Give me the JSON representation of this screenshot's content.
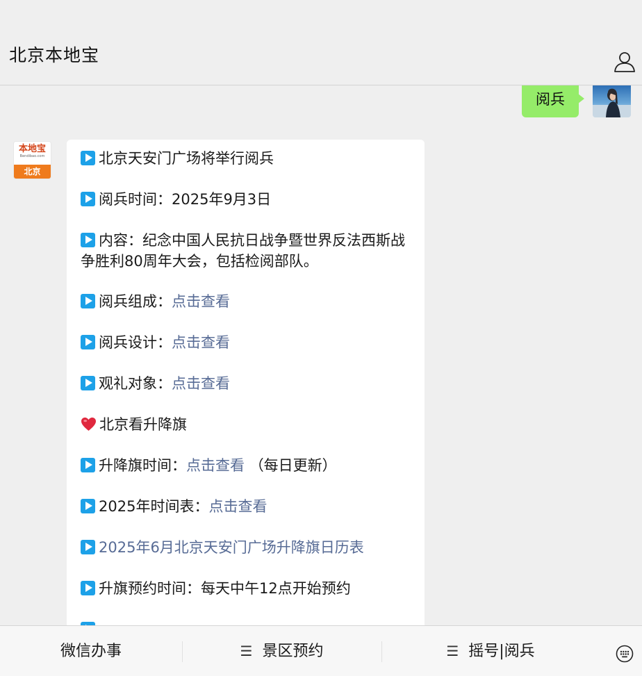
{
  "header": {
    "title": "北京本地宝"
  },
  "user_message": {
    "text": "阅兵"
  },
  "bot_avatar": {
    "brand": "本地宝",
    "url": "Bendibao.com",
    "city": "北京"
  },
  "bot_message": {
    "lines": {
      "l1": {
        "text": "北京天安门广场将举行阅兵"
      },
      "l2": {
        "text": "阅兵时间：2025年9月3日"
      },
      "l3": {
        "text": "内容：纪念中国人民抗日战争暨世界反法西斯战争胜利80周年大会，包括检阅部队。"
      },
      "l4": {
        "label": "阅兵组成：",
        "link": "点击查看"
      },
      "l5": {
        "label": "阅兵设计：",
        "link": "点击查看"
      },
      "l6": {
        "label": "观礼对象：",
        "link": "点击查看"
      },
      "l7": {
        "text": "北京看升降旗"
      },
      "l8": {
        "label": "升降旗时间：",
        "link": "点击查看",
        "suffix": "（每日更新）"
      },
      "l9": {
        "label": "2025年时间表：",
        "link": "点击查看"
      },
      "l10": {
        "link": "2025年6月北京天安门广场升降旗日历表"
      },
      "l11": {
        "text": "升旗预约时间：每天中午12点开始预约"
      }
    }
  },
  "footer": {
    "menu1": "微信办事",
    "menu2": "景区预约",
    "menu3": "摇号|阅兵"
  },
  "colors": {
    "user_bubble": "#95ec69",
    "link": "#576b95",
    "play_icon": "#1da1e8",
    "brand_orange": "#ef7b1d"
  }
}
